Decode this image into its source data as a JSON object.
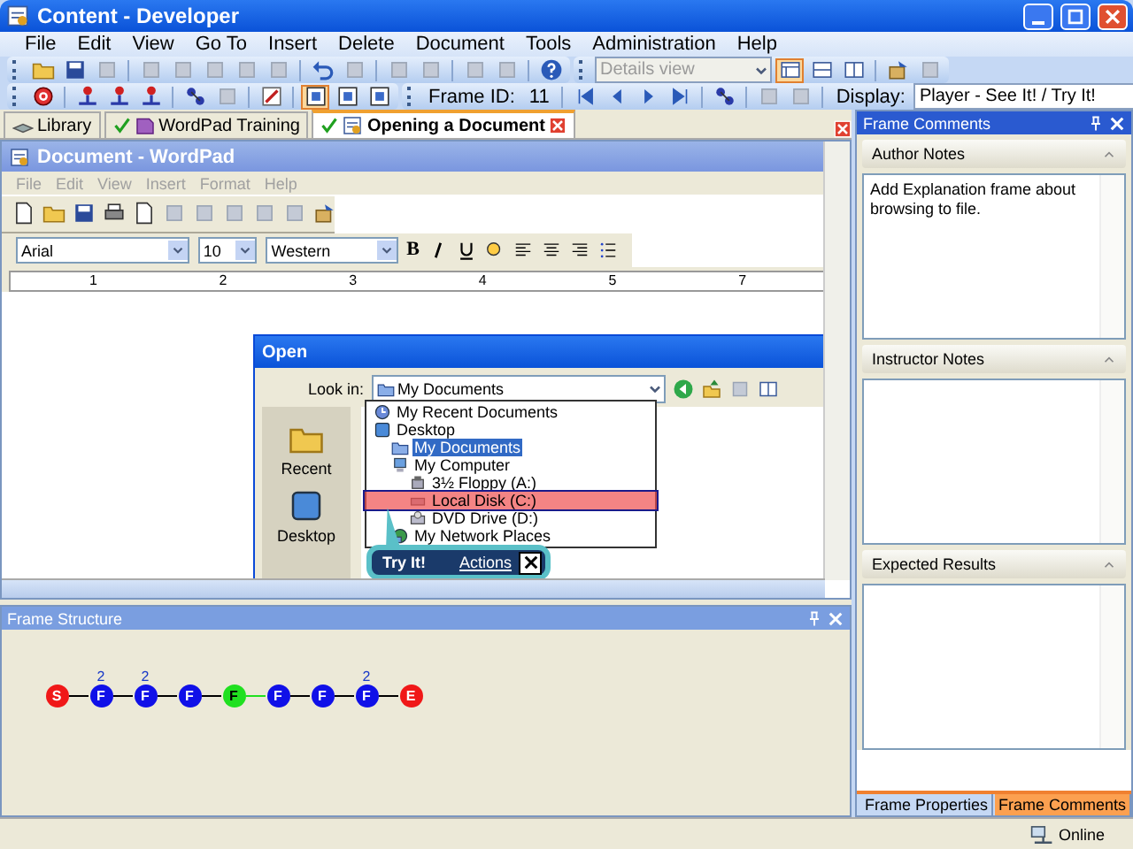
{
  "window": {
    "title": "Content - Developer"
  },
  "menu": [
    "File",
    "Edit",
    "View",
    "Go To",
    "Insert",
    "Delete",
    "Document",
    "Tools",
    "Administration",
    "Help"
  ],
  "toolbar": {
    "view_dropdown": {
      "value": "Details view",
      "disabled": true
    },
    "frame_id_label": "Frame ID:",
    "frame_id": "11",
    "display_label": "Display:",
    "display_value": "Player - See It! / Try It!"
  },
  "doc_tabs": [
    {
      "label": "Library",
      "kind": "library",
      "selected": false
    },
    {
      "label": "WordPad Training",
      "kind": "module",
      "selected": false
    },
    {
      "label": "Opening a Document",
      "kind": "topic",
      "selected": true
    }
  ],
  "preview": {
    "wordpad": {
      "title": "Document - WordPad",
      "menu": [
        {
          "label": "File",
          "disabled": true
        },
        {
          "label": "Edit",
          "disabled": true
        },
        {
          "label": "View",
          "disabled": true
        },
        {
          "label": "Insert",
          "disabled": true
        },
        {
          "label": "Format",
          "disabled": true
        },
        {
          "label": "Help",
          "disabled": true
        }
      ],
      "font": "Arial",
      "size": "10",
      "script": "Western",
      "bold_label": "B",
      "ruler": [
        "1",
        "2",
        "3",
        "4",
        "5",
        "7"
      ]
    },
    "dialog": {
      "title": "Open",
      "look_in_label": "Look in:",
      "look_in_value": "My Documents",
      "places": [
        "Recent",
        "Desktop"
      ],
      "tree": [
        {
          "label": "My Recent Documents",
          "kind": "recent",
          "selected": false,
          "hotspot": false
        },
        {
          "label": "Desktop",
          "kind": "desktop",
          "selected": false,
          "hotspot": false,
          "children": [
            {
              "label": "My Documents",
              "kind": "documents",
              "selected": true,
              "hotspot": false
            },
            {
              "label": "My Computer",
              "kind": "computer",
              "selected": false,
              "hotspot": false,
              "children": [
                {
                  "label": "3½ Floppy (A:)",
                  "kind": "floppy",
                  "selected": false,
                  "hotspot": false
                },
                {
                  "label": "Local Disk (C:)",
                  "kind": "disk",
                  "selected": false,
                  "hotspot": true
                },
                {
                  "label": "DVD Drive (D:)",
                  "kind": "dvd",
                  "selected": false,
                  "hotspot": false
                }
              ]
            },
            {
              "label": "My Network Places",
              "kind": "network",
              "selected": false,
              "hotspot": false
            }
          ]
        }
      ]
    },
    "callout": {
      "title": "Try It!",
      "link": "Actions"
    }
  },
  "frame_structure": {
    "title": "Frame Structure",
    "nodes": [
      {
        "label": "S",
        "kind": "start",
        "selected": false
      },
      {
        "label": "F",
        "kind": "frame",
        "selected": false,
        "badge": "2"
      },
      {
        "label": "F",
        "kind": "frame",
        "selected": false,
        "badge": "2"
      },
      {
        "label": "F",
        "kind": "frame",
        "selected": false
      },
      {
        "label": "F",
        "kind": "frame",
        "selected": true
      },
      {
        "label": "F",
        "kind": "frame",
        "selected": false
      },
      {
        "label": "F",
        "kind": "frame",
        "selected": false
      },
      {
        "label": "F",
        "kind": "frame",
        "selected": false,
        "badge": "2"
      },
      {
        "label": "E",
        "kind": "end",
        "selected": false
      }
    ]
  },
  "comments_panel": {
    "title": "Frame Comments",
    "sections": [
      {
        "title": "Author Notes",
        "value": "Add Explanation frame about browsing to file."
      },
      {
        "title": "Instructor Notes"
      },
      {
        "title": "Expected Results"
      }
    ],
    "tabs": [
      {
        "label": "Frame Properties",
        "selected": false
      },
      {
        "label": "Frame Comments",
        "selected": true
      }
    ]
  },
  "status_bar": {
    "status": "Online"
  }
}
